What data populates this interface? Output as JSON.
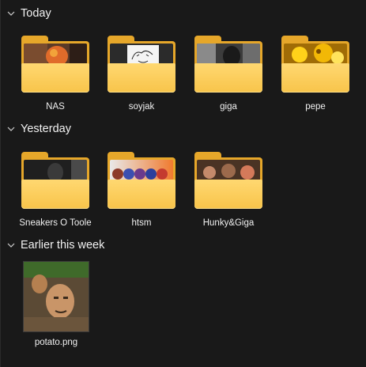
{
  "groups": [
    {
      "label": "Today"
    },
    {
      "label": "Yesterday"
    },
    {
      "label": "Earlier this week"
    }
  ],
  "today": [
    {
      "name": "NAS",
      "preview": "orange-statue"
    },
    {
      "name": "soyjak",
      "preview": "sketch-drawing"
    },
    {
      "name": "giga",
      "preview": "dark-portrait"
    },
    {
      "name": "pepe",
      "preview": "golden-art"
    }
  ],
  "yesterday": [
    {
      "name": "Sneakers O Toole",
      "preview": "dark-portrait"
    },
    {
      "name": "htsm",
      "preview": "fruit-row"
    },
    {
      "name": "Hunky&Giga",
      "preview": "faces"
    }
  ],
  "earlier": [
    {
      "name": "potato.png",
      "preview": "potato-faces"
    }
  ],
  "colors": {
    "background": "#191919",
    "folder_back": "#e6a72a",
    "folder_front": "#fbc94d",
    "text": "#f0f0f0"
  },
  "icons": [
    "chevron-down-icon",
    "folder-icon"
  ]
}
